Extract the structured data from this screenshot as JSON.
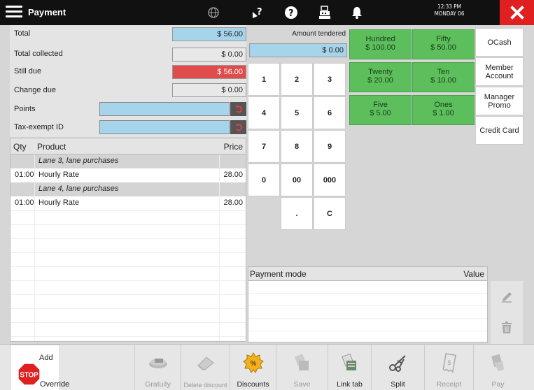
{
  "header": {
    "title": "Payment",
    "time": "12:33 PM",
    "day": "MONDAY 06"
  },
  "summary": {
    "total_label": "Total",
    "total_value": "$ 56.00",
    "collected_label": "Total collected",
    "collected_value": "$ 0.00",
    "still_due_label": "Still due",
    "still_due_value": "$ 56.00",
    "change_due_label": "Change due",
    "change_due_value": "$ 0.00",
    "points_label": "Points",
    "tax_label": "Tax-exempt ID"
  },
  "products": {
    "col_qty": "Qty",
    "col_product": "Product",
    "col_price": "Price",
    "groups": [
      {
        "title": "Lane 3, lane purchases",
        "qty": "01:00",
        "name": "Hourly Rate",
        "price": "28.00"
      },
      {
        "title": "Lane 4, lane purchases",
        "qty": "01:00",
        "name": "Hourly Rate",
        "price": "28.00"
      }
    ]
  },
  "tender": {
    "label": "Amount tendered",
    "value": "$ 0.00"
  },
  "keypad": [
    "1",
    "2",
    "3",
    "4",
    "5",
    "6",
    "7",
    "8",
    "9",
    "0",
    "00",
    "000",
    ".",
    "C"
  ],
  "denoms": [
    {
      "name": "Hundred",
      "value": "$ 100.00"
    },
    {
      "name": "Fifty",
      "value": "$ 50.00"
    },
    {
      "name": "Twenty",
      "value": "$ 20.00"
    },
    {
      "name": "Ten",
      "value": "$ 10.00"
    },
    {
      "name": "Five",
      "value": "$ 5.00"
    },
    {
      "name": "Ones",
      "value": "$ 1.00"
    }
  ],
  "payment_types": {
    "ocash": "OCash",
    "member": "Member Account",
    "manager": "Manager Promo",
    "credit": "Credit Card"
  },
  "payment_mode": {
    "col_mode": "Payment mode",
    "col_value": "Value"
  },
  "toolbar": {
    "add": "Add",
    "override": "Override",
    "gratuity": "Gratuity",
    "delete_discount": "Delete discount",
    "discounts": "Discounts",
    "save": "Save",
    "link_tab": "Link tab",
    "split": "Split",
    "receipt": "Receipt",
    "pay": "Pay"
  },
  "colors": {
    "topbar": "#111111",
    "close": "#e02020",
    "field_blue": "#a6d4ea",
    "field_red": "#e04c4c",
    "denom_green": "#5cbf5c"
  }
}
